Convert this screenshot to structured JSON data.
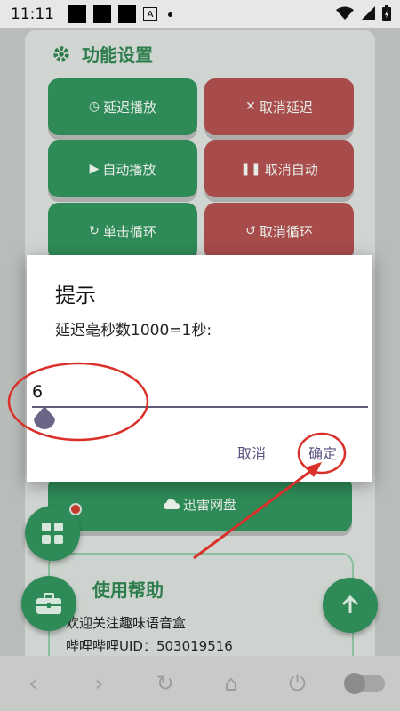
{
  "status_bar": {
    "time": "11:11",
    "notif_letter": "A"
  },
  "section": {
    "title": "功能设置"
  },
  "buttons": {
    "delay_play": "延迟播放",
    "cancel_delay": "取消延迟",
    "auto_play": "自动播放",
    "cancel_auto": "取消自动",
    "single_loop": "单击循环",
    "cancel_loop": "取消循环",
    "xunlei": "迅雷网盘"
  },
  "help": {
    "title": "使用帮助",
    "line1": "欢迎关注趣味语音盒",
    "line2": "哔哩哔哩UID：503019516"
  },
  "dialog": {
    "title": "提示",
    "message": "延迟毫秒数1000=1秒:",
    "input_value": "6",
    "cancel_label": "取消",
    "ok_label": "确定"
  },
  "colors": {
    "accent_green": "#2e8b57",
    "cancel_red": "#a84b4b",
    "dialog_text_button": "#5a5480",
    "annotation_red": "#d9302a"
  }
}
